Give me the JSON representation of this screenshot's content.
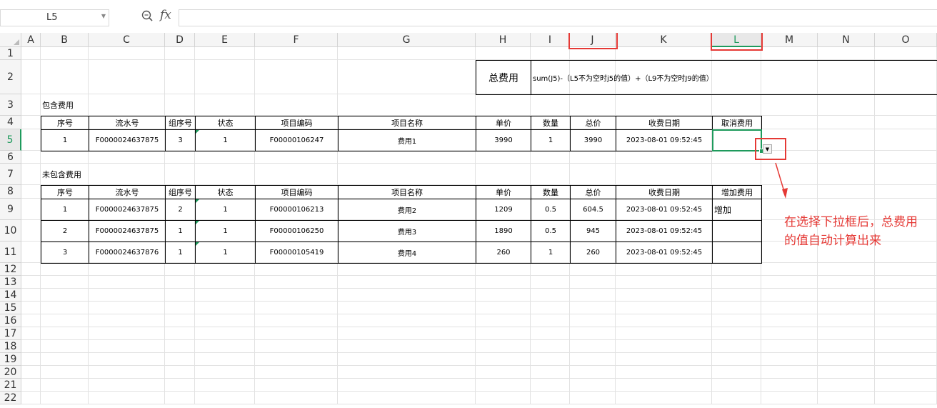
{
  "namebox": {
    "value": "L5"
  },
  "formula": {
    "value": ""
  },
  "columns": [
    "A",
    "B",
    "C",
    "D",
    "E",
    "F",
    "G",
    "H",
    "I",
    "J",
    "K",
    "L",
    "M",
    "N",
    "O"
  ],
  "rows": [
    "1",
    "2",
    "3",
    "4",
    "5",
    "6",
    "7",
    "8",
    "9",
    "10",
    "11",
    "12",
    "13",
    "14",
    "15",
    "16",
    "17",
    "18",
    "19",
    "20",
    "21",
    "22"
  ],
  "summary": {
    "label": "总费用",
    "formula_text": "sum(J5)-（L5不为空时j5的值）+（L9不为空时J9的值）"
  },
  "included": {
    "title": "包含费用",
    "headers": [
      "序号",
      "流水号",
      "组序号",
      "状态",
      "项目编码",
      "项目名称",
      "单价",
      "数量",
      "总价",
      "收费日期",
      "取消费用"
    ],
    "rows": [
      [
        "1",
        "F0000024637875",
        "3",
        "1",
        "F00000106247",
        "费用1",
        "3990",
        "1",
        "3990",
        "2023-08-01 09:52:45",
        ""
      ]
    ]
  },
  "excluded": {
    "title": "未包含费用",
    "headers": [
      "序号",
      "流水号",
      "组序号",
      "状态",
      "项目编码",
      "项目名称",
      "单价",
      "数量",
      "总价",
      "收费日期",
      "增加费用"
    ],
    "rows": [
      [
        "1",
        "F0000024637875",
        "2",
        "1",
        "F00000106213",
        "费用2",
        "1209",
        "0.5",
        "604.5",
        "2023-08-01 09:52:45",
        "增加"
      ],
      [
        "2",
        "F0000024637875",
        "1",
        "1",
        "F00000106250",
        "费用3",
        "1890",
        "0.5",
        "945",
        "2023-08-01 09:52:45",
        ""
      ],
      [
        "3",
        "F0000024637876",
        "1",
        "1",
        "F00000105419",
        "费用4",
        "260",
        "1",
        "260",
        "2023-08-01 09:52:45",
        ""
      ]
    ]
  },
  "annotation": {
    "text": "在选择下拉框后，总费用的值自动计算出来"
  },
  "colors": {
    "accent": "#1e9a5c",
    "annotation": "#e53935"
  }
}
